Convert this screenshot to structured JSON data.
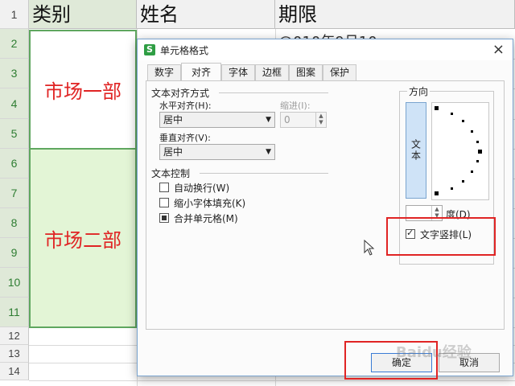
{
  "spreadsheet": {
    "columns": [
      "类别",
      "姓名",
      "期限"
    ],
    "row_numbers": [
      "1",
      "2",
      "3",
      "4",
      "5",
      "6",
      "7",
      "8",
      "9",
      "10",
      "11",
      "12",
      "13",
      "14"
    ],
    "merged_cells": [
      "市场一部",
      "市场二部"
    ],
    "partial_text": "@010年9月10"
  },
  "dialog": {
    "title": "单元格格式",
    "app_icon": "S",
    "close_icon": "×",
    "tabs": [
      "数字",
      "对齐",
      "字体",
      "边框",
      "图案",
      "保护"
    ],
    "active_tab": "对齐",
    "text_align": {
      "section": "文本对齐方式",
      "horizontal_label": "水平对齐(H):",
      "horizontal_value": "居中",
      "indent_label": "缩进(I):",
      "indent_value": "0",
      "vertical_label": "垂直对齐(V):",
      "vertical_value": "居中"
    },
    "text_control": {
      "section": "文本控制",
      "options": [
        {
          "label": "自动换行(W)",
          "checked": false
        },
        {
          "label": "缩小字体填充(K)",
          "checked": false
        },
        {
          "label": "合并单元格(M)",
          "checked": true
        }
      ]
    },
    "orientation": {
      "section": "方向",
      "vertical_text": "文本",
      "degree_label": "度(D)",
      "degree_value": "",
      "vertical_text_option": {
        "label": "文字竖排(L)",
        "checked": true
      }
    },
    "ok_label": "确定",
    "cancel_label": "取消"
  },
  "watermark": "Baidu经验",
  "colors": {
    "accent_green": "#2e7d32",
    "highlight_red": "#e02424",
    "selection_fill": "#e3f5d6"
  }
}
